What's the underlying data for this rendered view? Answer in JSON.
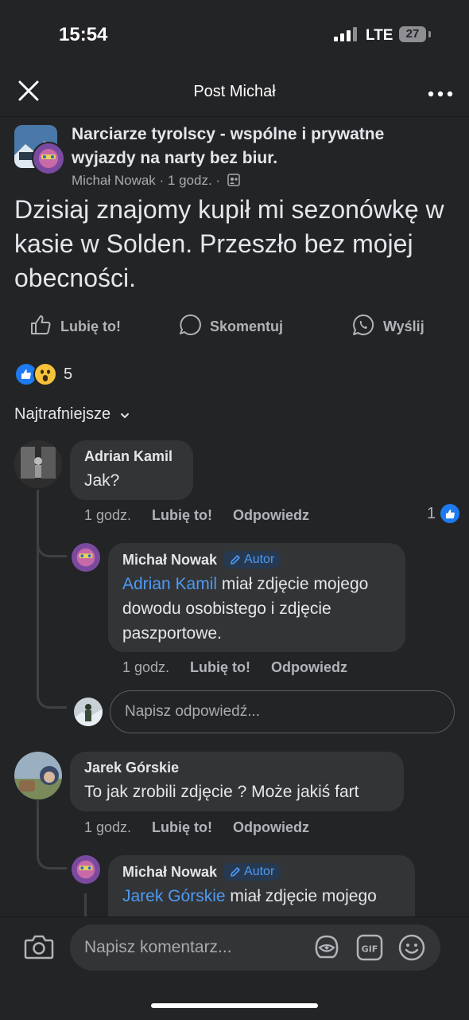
{
  "status_bar": {
    "time": "15:54",
    "network": "LTE",
    "battery": "27"
  },
  "header": {
    "title": "Post Michał"
  },
  "post": {
    "group_name": "Narciarze tyrolscy - wspólne i prywatne wyjazdy na narty bez biur.",
    "meta": "Michał Nowak · 1 godz. ·",
    "text": "Dzisiaj znajomy kupił mi sezonówkę w kasie w Solden. Przeszło bez mojej obecności.",
    "actions": {
      "like": "Lubię to!",
      "comment": "Skomentuj",
      "share": "Wyślij"
    },
    "reaction_count": "5"
  },
  "sort": {
    "label": "Najtrafniejsze"
  },
  "comments": [
    {
      "author": "Adrian Kamil",
      "text": "Jak?",
      "time": "1 godz.",
      "like": "Lubię to!",
      "reply": "Odpowiedz",
      "likes": "1",
      "replies": [
        {
          "author": "Michał Nowak",
          "badge": "Autor",
          "mention": "Adrian Kamil",
          "text": " miał zdjęcie mojego dowodu osobistego i zdjęcie paszportowe.",
          "time": "1 godz.",
          "like": "Lubię to!",
          "reply": "Odpowiedz"
        }
      ]
    },
    {
      "author": "Jarek Górskie",
      "text": "To jak zrobili zdjęcie ?  Może jakiś fart",
      "time": "1 godz.",
      "like": "Lubię to!",
      "reply": "Odpowiedz",
      "replies": [
        {
          "author": "Michał Nowak",
          "badge": "Autor",
          "mention": "Jarek Górskie",
          "text": " miał zdjęcie mojego"
        }
      ]
    }
  ],
  "reply_input": {
    "placeholder": "Napisz odpowiedź..."
  },
  "comment_input": {
    "placeholder": "Napisz komentarz..."
  },
  "icons": [
    "close-icon",
    "more-icon",
    "like-icon",
    "comment-icon",
    "whatsapp-icon",
    "chevron-down-icon",
    "camera-icon",
    "avatar-sticker-icon",
    "gif-icon",
    "emoji-icon"
  ],
  "colors": {
    "background": "#232426",
    "bubble": "#333436",
    "accent": "#4d9af5",
    "like_blue": "#1d7af0"
  }
}
